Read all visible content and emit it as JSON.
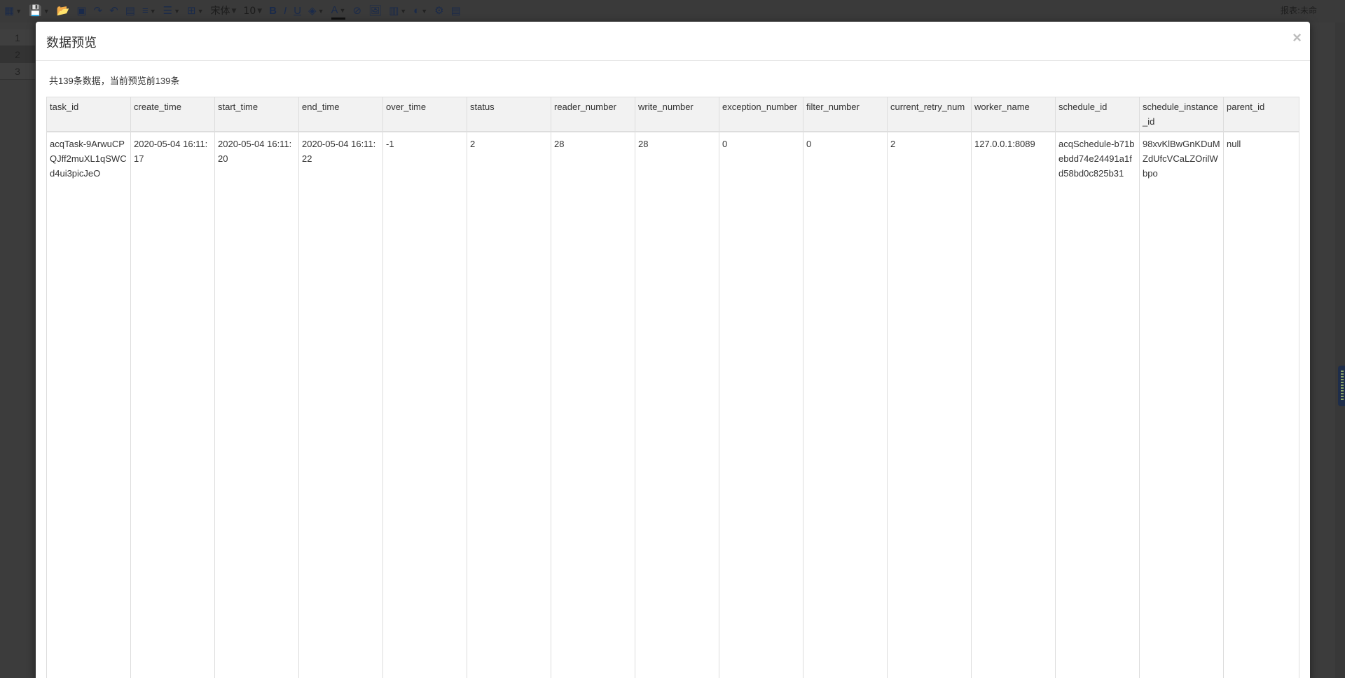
{
  "toolbar": {
    "icons": [
      "new-icon",
      "save-icon",
      "open-icon",
      "preview-icon",
      "redo-icon",
      "undo-icon",
      "grid-icon",
      "align-center-icon",
      "align-left-icon",
      "border-icon",
      "bold-icon",
      "italic-icon",
      "underline-icon",
      "fill-color-icon",
      "font-color-icon",
      "clear-icon",
      "image-icon",
      "chart-icon",
      "globe-icon",
      "settings-icon",
      "list-icon"
    ],
    "font_name": "宋体",
    "font_size": "10",
    "bold_glyph": "B",
    "italic_glyph": "I",
    "underline_glyph": "U",
    "font_color_glyph": "A",
    "right_text": "报表:未命"
  },
  "sheet": {
    "rows": [
      "1",
      "2",
      "3"
    ]
  },
  "modal": {
    "title": "数据预览",
    "close_label": "×",
    "summary": "共139条数据，当前预览前139条",
    "columns": [
      "task_id",
      "create_time",
      "start_time",
      "end_time",
      "over_time",
      "status",
      "reader_number",
      "write_number",
      "exception_number",
      "filter_number",
      "current_retry_num",
      "worker_name",
      "schedule_id",
      "schedule_instance_id",
      "parent_id"
    ],
    "rows": [
      [
        "acqTask-9ArwuCPQJff2muXL1qSWCd4ui3picJeO",
        "2020-05-04 16:11:17",
        "2020-05-04 16:11:20",
        "2020-05-04 16:11:22",
        "-1",
        "2",
        "28",
        "28",
        "0",
        "0",
        "2",
        "127.0.0.1:8089",
        "acqSchedule-b71bebdd74e24491a1fd58bd0c825b31",
        "98xvKlBwGnKDuMZdUfcVCaLZOrilWbpo",
        "null"
      ]
    ]
  }
}
